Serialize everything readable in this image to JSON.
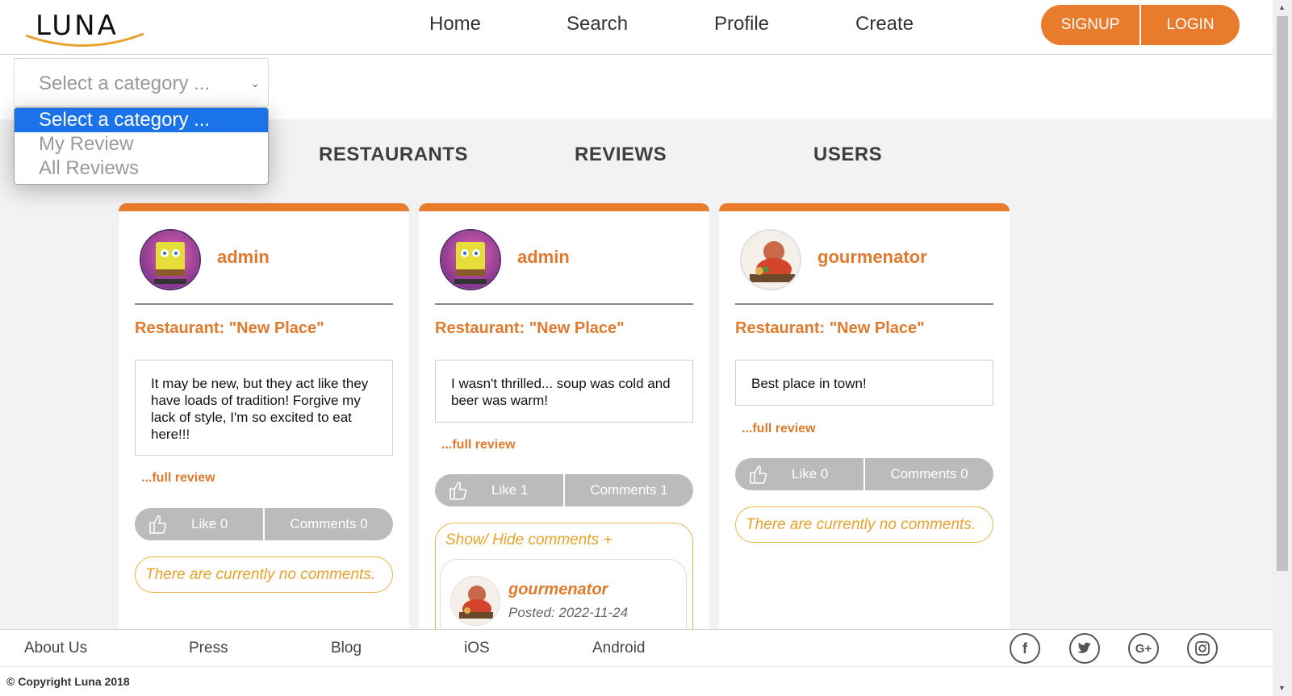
{
  "header": {
    "logo_text": "LUNA",
    "nav": [
      "Home",
      "Search",
      "Profile",
      "Create"
    ],
    "signup_label": "SIGNUP",
    "login_label": "LOGIN"
  },
  "category_select": {
    "placeholder": "Select a category ...",
    "options": [
      "Select a category ...",
      "My Review",
      "All Reviews"
    ],
    "selected_index": 0
  },
  "tabs": [
    "RESTAURANTS",
    "REVIEWS",
    "USERS"
  ],
  "cards": [
    {
      "username": "admin",
      "restaurant": "Restaurant: \"New Place\"",
      "review": "It may be new, but they act like they have loads of tradition! Forgive my lack of style, I'm so excited to eat here!!!",
      "full_review": "...full review",
      "like_label": "Like 0",
      "comments_label": "Comments 0",
      "comments_note": "There are currently no comments."
    },
    {
      "username": "admin",
      "restaurant": "Restaurant: \"New Place\"",
      "review": "I wasn't thrilled... soup was cold and beer was warm!",
      "full_review": "...full review",
      "like_label": "Like 1",
      "comments_label": "Comments 1",
      "show_hide_label": "Show/ Hide comments +",
      "comment": {
        "username": "gourmenator",
        "posted": "Posted: 2022-11-24"
      }
    },
    {
      "username": "gourmenator",
      "restaurant": "Restaurant: \"New Place\"",
      "review": "Best place in town!",
      "full_review": "...full review",
      "like_label": "Like 0",
      "comments_label": "Comments 0",
      "comments_note": "There are currently no comments."
    }
  ],
  "footer": {
    "links": [
      "About Us",
      "Press",
      "Blog",
      "iOS",
      "Android"
    ],
    "social_icons": [
      "facebook-icon",
      "twitter-icon",
      "google-plus-icon",
      "instagram-icon"
    ],
    "copyright": "© Copyright Luna 2018"
  },
  "colors": {
    "accent": "#e87c2c",
    "accent_text": "#e07a2e",
    "comment_border": "#e8b84a",
    "comment_text": "#e8a22a",
    "button_grey": "#bbbbbb",
    "content_bg": "#f2f2f2",
    "dropdown_highlight": "#1a73e8"
  }
}
